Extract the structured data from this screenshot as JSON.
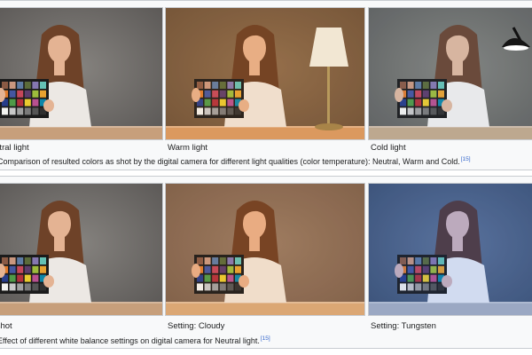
{
  "row1": {
    "captions": [
      "Neutral light",
      "Warm light",
      "Cold light"
    ],
    "gallery_caption": "Comparison of resulted colors as shot by the digital camera for different light qualities (color temperature): Neutral, Warm and Cold.",
    "reference": "[15]"
  },
  "row2": {
    "captions": [
      "As shot",
      "Setting: Cloudy",
      "Setting: Tungsten"
    ],
    "gallery_caption": "Effect of different white balance settings on digital camera for Neutral light.",
    "reference": "[15]"
  },
  "colors": {
    "neutral_bg": "#5a5755",
    "warm_bg": "#6a5038",
    "cold_bg": "#5f605e",
    "cloudy_bg": "#7a5e4a",
    "tungsten_bg": "#3d5170",
    "table_neutral": "#c79f7b",
    "table_warm": "#d89a62",
    "hair": "#6e4228",
    "link_blue": "#3366cc"
  }
}
